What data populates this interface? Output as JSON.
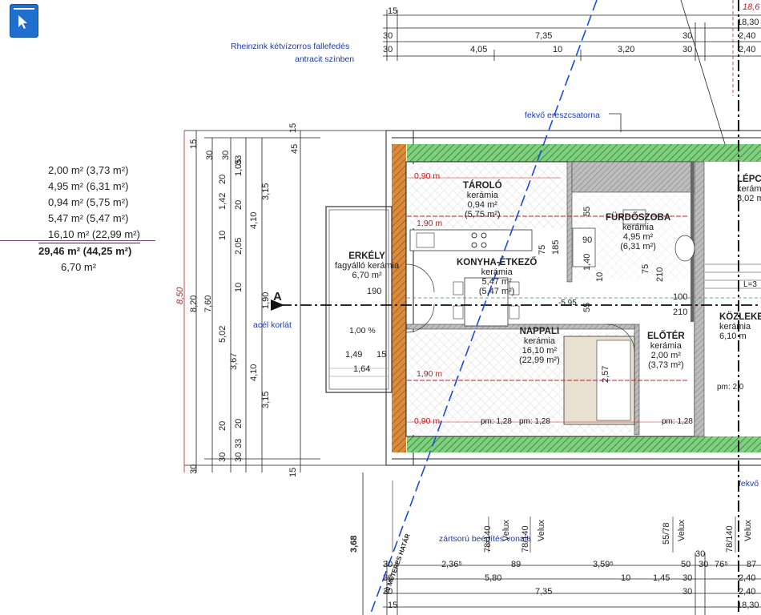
{
  "toolbar": {
    "select_tool": "cursor-icon"
  },
  "areas": {
    "rows": [
      "2,00 m² (3,73 m²)",
      "4,95 m² (6,31 m²)",
      "0,94 m² (5,75 m²)",
      "5,47 m² (5,47 m²)",
      "16,10 m² (22,99 m²)"
    ],
    "total": "29,46 m² (44,25 m²)",
    "balcony": "6,70 m²"
  },
  "annotations": {
    "roof_note_1": "Rheinzink kétvízorros fallefedés",
    "roof_note_2": "antracit színben",
    "gutter_top": "fekvő ereszcsatorna",
    "gutter_right": "fekvő",
    "railing": "acél korlát",
    "slope": "1,00 %",
    "boundary": "20 MÉTERES HATÁR",
    "closed_build": "zártsorú beépítés vonala",
    "section_mark": "A",
    "level": "-5,95",
    "height_total": "8,50",
    "dim_368": "3,68",
    "dim_186": "18,6"
  },
  "rooms": {
    "storage": {
      "name": "TÁROLÓ",
      "floor": "kerámia",
      "area": "0,94 m²",
      "gross": "(5,75 m²)"
    },
    "bathroom": {
      "name": "FÜRDŐSZOBA",
      "floor": "kerámia",
      "area": "4,95 m²",
      "gross": "(6,31 m²)"
    },
    "kitchen": {
      "name": "KONYHA-ÉTKEZŐ",
      "floor": "kerámia",
      "area": "5,47 m²",
      "gross": "(5,47 m²)"
    },
    "living": {
      "name": "NAPPALI",
      "floor": "kerámia",
      "area": "16,10 m²",
      "gross": "(22,99 m²)"
    },
    "hall": {
      "name": "ELŐTÉR",
      "floor": "kerámia",
      "area": "2,00 m²",
      "gross": "(3,73 m²)"
    },
    "balcony": {
      "name": "ERKÉLY",
      "floor": "fagyálló kerámia",
      "area": "6,70 m²"
    },
    "stairs": {
      "name": "LÉPCS",
      "floor": "kerámi",
      "area": "8,02 m"
    },
    "corridor": {
      "name": "KÖZLEKE",
      "floor": "kerámia",
      "area": "6,10 m"
    }
  },
  "red_labels": [
    "0,90 m",
    "1,90 m",
    "1,90 m",
    "0,90 m"
  ],
  "top_dims": {
    "row1": [
      "15",
      "18,30"
    ],
    "row2": [
      "30",
      "7,35",
      "30",
      "2,40"
    ],
    "row3": [
      "30",
      "4,05",
      "10",
      "3,20",
      "30",
      "2,40"
    ]
  },
  "bottom_dims": {
    "row1": [
      "30",
      "2,36⁵",
      "89",
      "3,59⁵",
      "50",
      "30",
      "76⁵",
      "87"
    ],
    "row2": [
      "30",
      "5,80",
      "10",
      "1,45",
      "30",
      "2,40"
    ],
    "row3": [
      "30",
      "7,35",
      "30",
      "2,40"
    ],
    "row4": [
      "15",
      "18,30"
    ],
    "top30": "30"
  },
  "windows": [
    "78/140",
    "Velux",
    "78/140",
    "Velux",
    "55/78",
    "Velux",
    "78/140",
    "Velux"
  ],
  "left_dims": {
    "col_a": [
      "15",
      "8,20",
      "30"
    ],
    "col_b": [
      "7,60"
    ],
    "col_c": [
      "30",
      "20",
      "1,42",
      "10",
      "5,02",
      "3,67",
      "20",
      "30"
    ],
    "col_d": [
      "30",
      "33",
      "1,05",
      "20",
      "2,05",
      "10",
      "20",
      "33",
      "30"
    ],
    "col_e": [
      "4,10",
      "4,10"
    ],
    "col_f": [
      "3,15",
      "1,90",
      "3,15"
    ],
    "col_g": [
      "15",
      "45",
      "15"
    ]
  },
  "inner_dims": [
    "190",
    "1,49",
    "15",
    "1,64",
    "75",
    "185",
    "55",
    "1,40",
    "90",
    "10",
    "75",
    "210",
    "100",
    "210",
    "2,57",
    "pm: 1,28",
    "pm: 1,28",
    "pm: 1,28",
    "pm: 2,0",
    "55",
    "L=3"
  ]
}
